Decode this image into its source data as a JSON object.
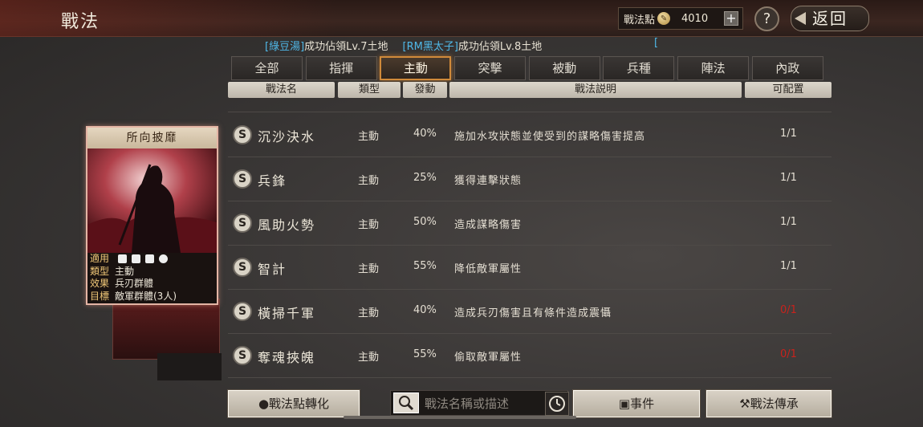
{
  "header": {
    "title": "戰法",
    "points_label": "戰法點",
    "points_value": "4010",
    "plus_label": "+",
    "help_label": "?",
    "back_label": "返回"
  },
  "ticker": {
    "items": [
      {
        "name": "[綠豆湯]",
        "text": "成功佔領Lv.7土地"
      },
      {
        "name": "[RM黑太子]",
        "text": "成功佔領Lv.8土地"
      }
    ],
    "trailing": "["
  },
  "tabs": [
    {
      "label": "全部",
      "active": false
    },
    {
      "label": "指揮",
      "active": false
    },
    {
      "label": "主動",
      "active": true
    },
    {
      "label": "突擊",
      "active": false
    },
    {
      "label": "被動",
      "active": false
    },
    {
      "label": "兵種",
      "active": false
    },
    {
      "label": "陣法",
      "active": false
    },
    {
      "label": "內政",
      "active": false
    }
  ],
  "columns": {
    "name": "戰法名",
    "type": "類型",
    "rate": "發動",
    "desc": "戰法説明",
    "assign": "可配置"
  },
  "rows": [
    {
      "grade": "S",
      "name": "沉沙決水",
      "type": "主動",
      "rate": "40%",
      "desc": "施加水攻狀態並使受到的謀略傷害提高",
      "assign": "1/1",
      "assign_red": false
    },
    {
      "grade": "S",
      "name": "兵鋒",
      "type": "主動",
      "rate": "25%",
      "desc": "獲得連擊狀態",
      "assign": "1/1",
      "assign_red": false
    },
    {
      "grade": "S",
      "name": "風助火勢",
      "type": "主動",
      "rate": "50%",
      "desc": "造成謀略傷害",
      "assign": "1/1",
      "assign_red": false
    },
    {
      "grade": "S",
      "name": "智計",
      "type": "主動",
      "rate": "55%",
      "desc": "降低敵軍屬性",
      "assign": "1/1",
      "assign_red": false
    },
    {
      "grade": "S",
      "name": "橫掃千軍",
      "type": "主動",
      "rate": "40%",
      "desc": "造成兵刃傷害且有條件造成震懾",
      "assign": "0/1",
      "assign_red": true
    },
    {
      "grade": "S",
      "name": "奪魂挾魄",
      "type": "主動",
      "rate": "55%",
      "desc": "偷取敵軍屬性",
      "assign": "0/1",
      "assign_red": true
    }
  ],
  "card": {
    "title": "所向披靡",
    "apply_label": "適用",
    "type_label": "類型",
    "type_value": "主動",
    "effect_label": "效果",
    "effect_value": "兵刃群體",
    "target_label": "目標",
    "target_value": "敵軍群體(3人)",
    "apply_icons": [
      "cavalry-icon",
      "shield-icon",
      "bow-icon",
      "wheel-icon"
    ]
  },
  "bottom": {
    "convert_label": "戰法點轉化",
    "search_placeholder": "戰法名稱或描述",
    "events_label": "事件",
    "inherit_label": "戰法傳承"
  }
}
